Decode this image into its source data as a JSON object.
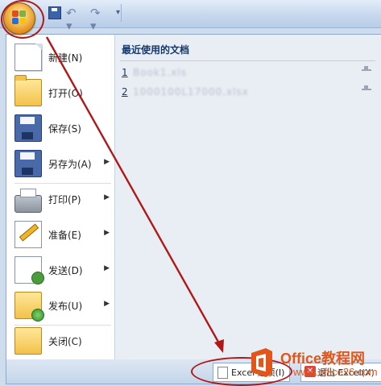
{
  "qat": {
    "icons": [
      "office-button-icon",
      "save-icon",
      "undo-icon",
      "redo-icon",
      "customize-qat-icon"
    ]
  },
  "menu": {
    "items": [
      {
        "label": "新建(N)",
        "icon": "new-document-icon",
        "has_submenu": false
      },
      {
        "label": "打开(O)",
        "icon": "open-folder-icon",
        "has_submenu": false
      },
      {
        "label": "保存(S)",
        "icon": "save-disk-icon",
        "has_submenu": false
      },
      {
        "label": "另存为(A)",
        "icon": "save-as-icon",
        "has_submenu": true
      },
      {
        "label": "打印(P)",
        "icon": "printer-icon",
        "has_submenu": true
      },
      {
        "label": "准备(E)",
        "icon": "prepare-icon",
        "has_submenu": true
      },
      {
        "label": "发送(D)",
        "icon": "send-icon",
        "has_submenu": true
      },
      {
        "label": "发布(U)",
        "icon": "publish-icon",
        "has_submenu": true
      },
      {
        "label": "关闭(C)",
        "icon": "close-folder-icon",
        "has_submenu": false
      }
    ],
    "submenu_arrow": "▶"
  },
  "recent": {
    "title": "最近使用的文档",
    "docs": [
      {
        "num": "1",
        "name": "Book1.xls"
      },
      {
        "num": "2",
        "name": "1000100L17000.xlsx"
      }
    ]
  },
  "bottom": {
    "excel_options_label": "Excel 选项(I)",
    "exit_label": "退出 Excel(X)"
  },
  "watermark": {
    "line1": "Office教程网",
    "line2": "www.office26.com"
  },
  "colors": {
    "annotation": "#b01818",
    "watermark": "#e2561a",
    "menu_border": "#8ea9cf"
  }
}
